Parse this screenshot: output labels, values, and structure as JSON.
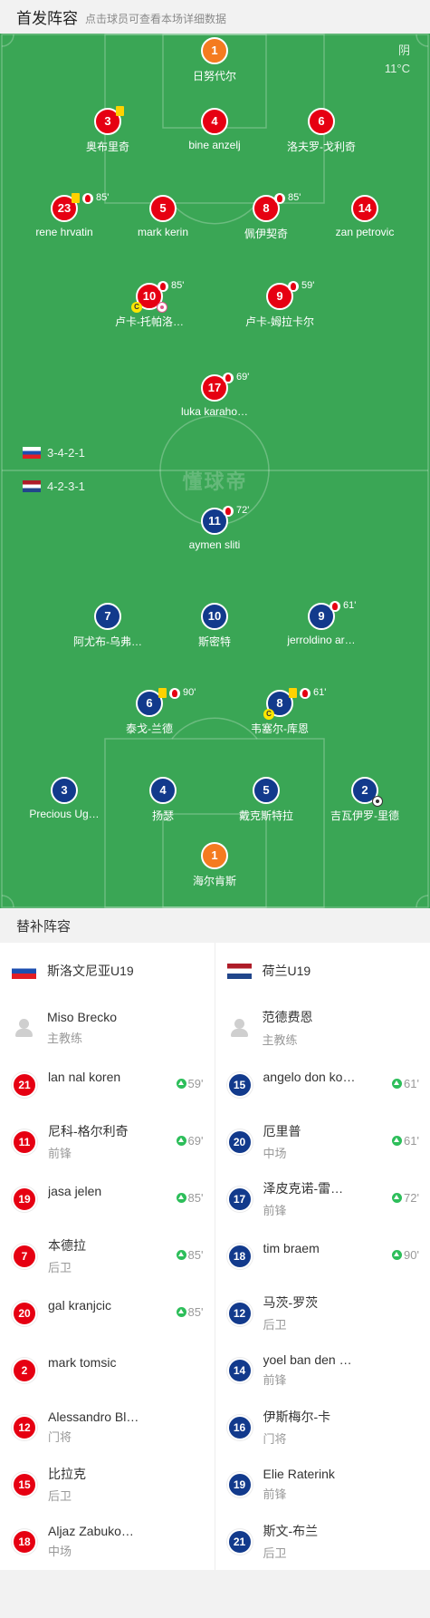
{
  "header": {
    "title": "首发阵容",
    "subtitle": "点击球员可查看本场详细数据"
  },
  "weather": {
    "condition": "阴",
    "temperature": "11°C"
  },
  "watermark": "懂球帝",
  "formations": {
    "home": {
      "flag": "slovenia-flag",
      "value": "3-4-2-1"
    },
    "away": {
      "flag": "netherlands-flag",
      "value": "4-2-3-1"
    }
  },
  "home_players": [
    {
      "number": "1",
      "name": "日努代尔"
    },
    {
      "number": "3",
      "name": "奥布里奇"
    },
    {
      "number": "4",
      "name": "bine anzelj"
    },
    {
      "number": "6",
      "name": "洛夫罗-戈利奇"
    },
    {
      "number": "23",
      "name": "rene hrvatin",
      "sub_minute": "85'"
    },
    {
      "number": "5",
      "name": "mark kerin"
    },
    {
      "number": "8",
      "name": "佩伊契奇",
      "sub_minute": "85'"
    },
    {
      "number": "14",
      "name": "zan petrovic"
    },
    {
      "number": "10",
      "name": "卢卡-托帕洛…",
      "sub_minute": "85'",
      "captain": "C"
    },
    {
      "number": "9",
      "name": "卢卡-姆拉卡尔",
      "sub_minute": "59'"
    },
    {
      "number": "17",
      "name": "luka karaho…",
      "sub_minute": "69'"
    }
  ],
  "away_players": [
    {
      "number": "11",
      "name": "aymen sliti",
      "sub_minute": "72'"
    },
    {
      "number": "7",
      "name": "阿尤布-乌弗…"
    },
    {
      "number": "10",
      "name": "斯密特"
    },
    {
      "number": "9",
      "name": "jerroldino ar…",
      "sub_minute": "61'"
    },
    {
      "number": "6",
      "name": "泰戈-兰德",
      "sub_minute": "90'"
    },
    {
      "number": "8",
      "name": "韦塞尔-库恩",
      "sub_minute": "61'",
      "captain": "C"
    },
    {
      "number": "3",
      "name": "Precious Ug…"
    },
    {
      "number": "4",
      "name": "扬瑟"
    },
    {
      "number": "5",
      "name": "戴克斯特拉"
    },
    {
      "number": "2",
      "name": "吉瓦伊罗-里德"
    },
    {
      "number": "1",
      "name": "海尔肯斯"
    }
  ],
  "subs_title": "替补阵容",
  "home_subs": {
    "team": "斯洛文尼亚U19",
    "coach": {
      "name": "Miso Brecko",
      "role": "主教练"
    },
    "players": [
      {
        "number": "21",
        "name": "lan nal koren",
        "position": "",
        "in": "59'"
      },
      {
        "number": "11",
        "name": "尼科-格尔利奇",
        "position": "前锋",
        "in": "69'"
      },
      {
        "number": "19",
        "name": "jasa jelen",
        "position": "",
        "in": "85'"
      },
      {
        "number": "7",
        "name": "本德拉",
        "position": "后卫",
        "in": "85'"
      },
      {
        "number": "20",
        "name": "gal kranjcic",
        "position": "",
        "in": "85'"
      },
      {
        "number": "2",
        "name": "mark tomsic",
        "position": "",
        "in": ""
      },
      {
        "number": "12",
        "name": "Alessandro Bl…",
        "position": "门将",
        "in": ""
      },
      {
        "number": "15",
        "name": "比拉克",
        "position": "后卫",
        "in": ""
      },
      {
        "number": "18",
        "name": "Aljaz Zabuko…",
        "position": "中场",
        "in": ""
      }
    ]
  },
  "away_subs": {
    "team": "荷兰U19",
    "coach": {
      "name": "范德费恩",
      "role": "主教练"
    },
    "players": [
      {
        "number": "15",
        "name": "angelo don ko…",
        "position": "",
        "in": "61'"
      },
      {
        "number": "20",
        "name": "厄里普",
        "position": "中场",
        "in": "61'"
      },
      {
        "number": "17",
        "name": "泽皮克诺-雷…",
        "position": "前锋",
        "in": "72'"
      },
      {
        "number": "18",
        "name": "tim braem",
        "position": "",
        "in": "90'"
      },
      {
        "number": "12",
        "name": "马茨-罗茨",
        "position": "后卫",
        "in": ""
      },
      {
        "number": "14",
        "name": "yoel ban den …",
        "position": "前锋",
        "in": ""
      },
      {
        "number": "16",
        "name": "伊斯梅尔-卡",
        "position": "门将",
        "in": ""
      },
      {
        "number": "19",
        "name": "Elie Raterink",
        "position": "前锋",
        "in": ""
      },
      {
        "number": "21",
        "name": "斯文-布兰",
        "position": "后卫",
        "in": ""
      }
    ]
  }
}
